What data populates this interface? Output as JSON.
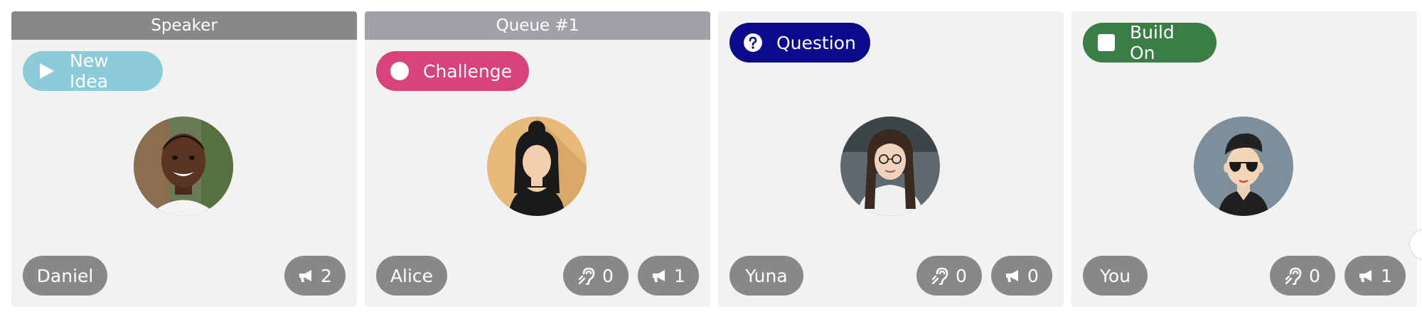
{
  "colors": {
    "card_bg": "#f2f2f3",
    "speaker_header": "#888888",
    "queue_header": "#a2a2a6",
    "new_idea": "#8cccd8",
    "challenge": "#d9427a",
    "question": "#0a0a8c",
    "build_on": "#3a7d45",
    "pill_grey": "#888888"
  },
  "cards": [
    {
      "header": "Speaker",
      "tag": {
        "label": "New Idea",
        "icon": "play-icon"
      },
      "avatar": "avatar-boy-photo",
      "name": "Daniel",
      "speak_count": "2"
    },
    {
      "header": "Queue #1",
      "tag": {
        "label": "Challenge",
        "icon": "circle-icon"
      },
      "avatar": "avatar-woman-illustration",
      "name": "Alice",
      "listen_count": "0",
      "speak_count": "1"
    },
    {
      "tag": {
        "label": "Question",
        "icon": "question-icon"
      },
      "avatar": "avatar-woman-glasses-photo",
      "name": "Yuna",
      "listen_count": "0",
      "speak_count": "0"
    },
    {
      "tag": {
        "label": "Build On",
        "icon": "square-icon"
      },
      "avatar": "avatar-man-sunglasses-illustration",
      "name": "You",
      "listen_count": "0",
      "speak_count": "1"
    }
  ]
}
